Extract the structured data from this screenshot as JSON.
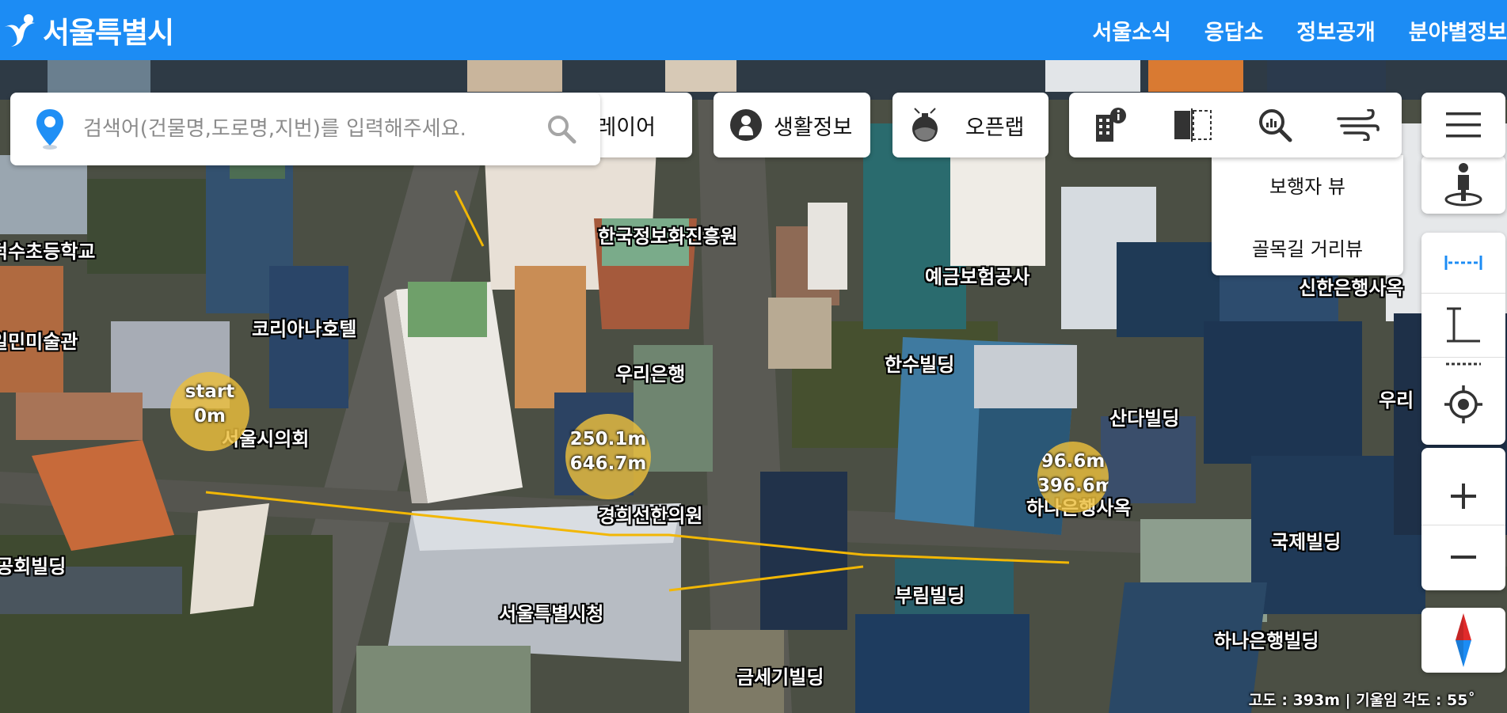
{
  "header": {
    "logo_text": "서울특별시",
    "nav": [
      "서울소식",
      "응답소",
      "정보공개",
      "분야별정보"
    ]
  },
  "search": {
    "placeholder": "검색어(건물명,도로명,지번)를 입력해주세요."
  },
  "toolbar": {
    "layer_label": "레이어",
    "life_info_label": "생활정보",
    "openlab_label": "오픈랩",
    "tool_icons": [
      "building-info-icon",
      "split-view-icon",
      "analysis-search-icon",
      "wind-icon"
    ]
  },
  "view_menu": {
    "items": [
      "보행자 뷰",
      "골목길 거리뷰"
    ]
  },
  "sidebar": {
    "icons": [
      "menu-icon",
      "pedestrian-icon",
      "distance-measure-icon",
      "height-measure-icon",
      "area-measure-icon",
      "locate-icon",
      "zoom-in-icon",
      "zoom-out-icon",
      "compass-icon"
    ]
  },
  "map_labels": [
    "한국정보화진흥원",
    "예금보험공사",
    "덕수초등학교",
    "코리아나호텔",
    "일민미술관",
    "우리은행",
    "한수빌딩",
    "신한은행사옥",
    "산다빌딩",
    "서울시의회",
    "경희선한의원",
    "하나은행사옥",
    "국제빌딩",
    "공회빌딩",
    "서울특별시청",
    "부림빌딩",
    "하나은행빌딩",
    "금세기빌딩",
    "우리"
  ],
  "measure_markers": [
    {
      "line1": "start",
      "line2": "0m"
    },
    {
      "line1": "250.1m",
      "line2": "646.7m"
    },
    {
      "line1": "96.6m",
      "line2": "396.6m"
    }
  ],
  "status": {
    "text": "고도 : 393m  |  기울임 각도 : 55˚"
  },
  "colors": {
    "header_blue": "#1c8cf4",
    "measure_line": "#f2b705",
    "marker_fill": "#ebbe3c"
  }
}
